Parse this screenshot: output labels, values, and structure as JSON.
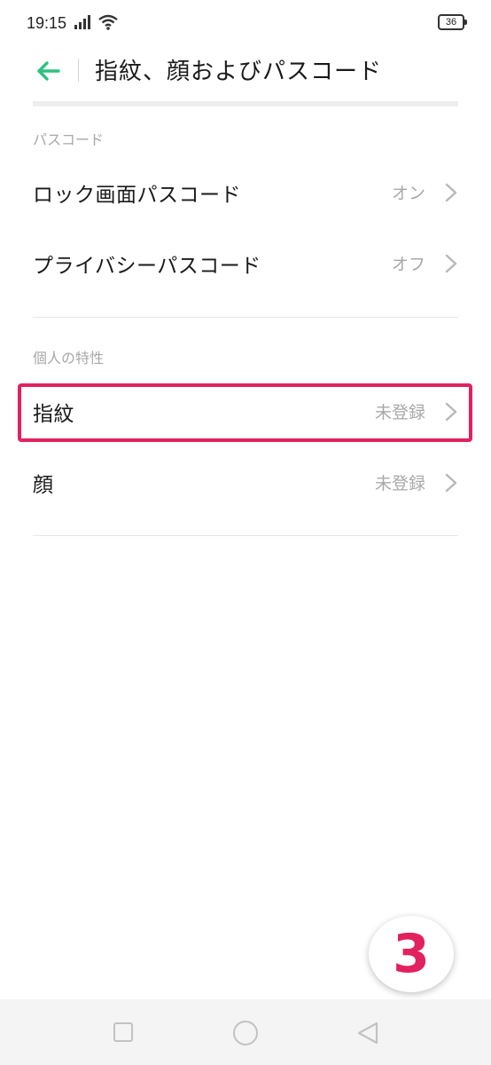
{
  "status_bar": {
    "time": "19:15",
    "battery": "36",
    "icons": [
      "signal-icon",
      "wifi-icon",
      "battery-icon"
    ]
  },
  "header": {
    "title": "指紋、顔およびパスコード",
    "back_icon": "arrow-left-icon",
    "accent_color": "#2ec27e"
  },
  "sections": [
    {
      "label": "パスコード",
      "items": [
        {
          "label": "ロック画面パスコード",
          "value": "オン"
        },
        {
          "label": "プライバシーパスコード",
          "value": "オフ"
        }
      ]
    },
    {
      "label": "個人の特性",
      "items": [
        {
          "label": "指紋",
          "value": "未登録",
          "highlighted": true
        },
        {
          "label": "顔",
          "value": "未登録"
        }
      ]
    }
  ],
  "annotation": {
    "step_number": "3",
    "highlight_color": "#e2215e"
  },
  "nav_bar": {
    "buttons": [
      "recent-apps-icon",
      "home-icon",
      "back-triangle-icon"
    ]
  }
}
